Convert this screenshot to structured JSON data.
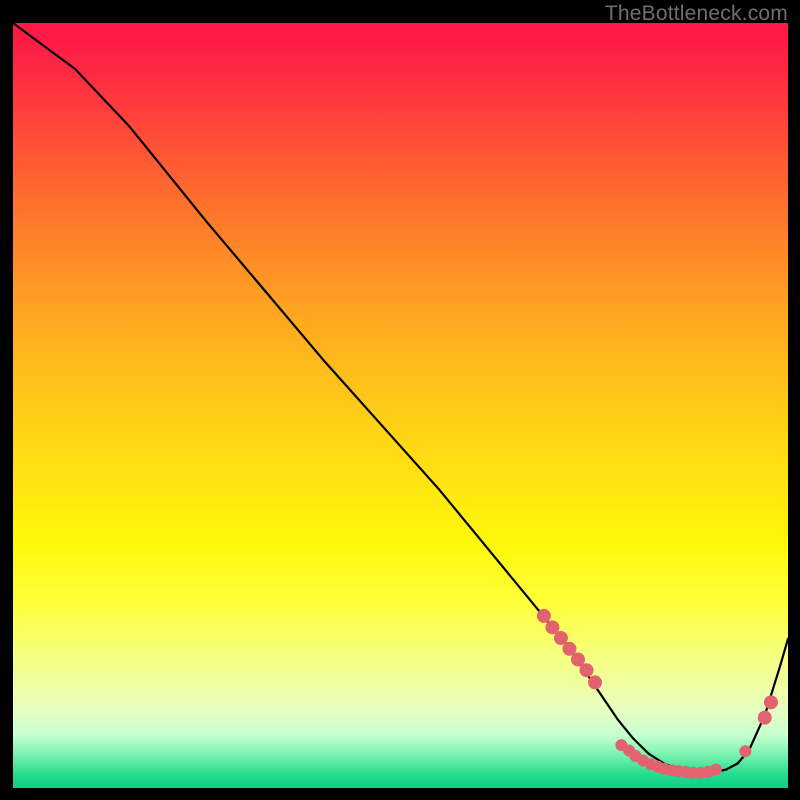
{
  "watermark": "TheBottleneck.com",
  "chart_data": {
    "type": "line",
    "title": "",
    "xlabel": "",
    "ylabel": "",
    "xlim": [
      0,
      100
    ],
    "ylim": [
      0,
      100
    ],
    "series": [
      {
        "name": "curve",
        "x": [
          0,
          4,
          8,
          15,
          25,
          40,
          55,
          68,
          72,
          74,
          76,
          78,
          80,
          82,
          84,
          86,
          88,
          90,
          92,
          93.5,
          95,
          97,
          99,
          100
        ],
        "y": [
          100,
          97,
          94,
          86.5,
          74,
          56,
          39,
          23,
          18,
          15,
          12,
          9,
          6.5,
          4.5,
          3.2,
          2.4,
          2.0,
          2.0,
          2.4,
          3.2,
          5.0,
          9.5,
          16,
          19.5
        ]
      }
    ],
    "dots": {
      "name": "highlight-points",
      "color": "#e2636f",
      "radius_major": 7,
      "radius_minor": 6,
      "points": [
        {
          "x": 68.5,
          "y": 22.5,
          "r": 7
        },
        {
          "x": 69.6,
          "y": 21.0,
          "r": 7
        },
        {
          "x": 70.7,
          "y": 19.6,
          "r": 7
        },
        {
          "x": 71.8,
          "y": 18.2,
          "r": 7
        },
        {
          "x": 72.9,
          "y": 16.8,
          "r": 7
        },
        {
          "x": 74.0,
          "y": 15.4,
          "r": 7
        },
        {
          "x": 75.1,
          "y": 13.8,
          "r": 7
        },
        {
          "x": 78.5,
          "y": 5.6,
          "r": 6
        },
        {
          "x": 79.5,
          "y": 4.9,
          "r": 6
        },
        {
          "x": 80.3,
          "y": 4.2,
          "r": 6
        },
        {
          "x": 81.3,
          "y": 3.6,
          "r": 6
        },
        {
          "x": 82.3,
          "y": 3.1,
          "r": 6
        },
        {
          "x": 83.2,
          "y": 2.8,
          "r": 6
        },
        {
          "x": 84.0,
          "y": 2.5,
          "r": 6
        },
        {
          "x": 85.0,
          "y": 2.3,
          "r": 6
        },
        {
          "x": 85.8,
          "y": 2.2,
          "r": 6
        },
        {
          "x": 86.8,
          "y": 2.1,
          "r": 6
        },
        {
          "x": 87.7,
          "y": 2.0,
          "r": 6
        },
        {
          "x": 88.7,
          "y": 2.0,
          "r": 6
        },
        {
          "x": 89.7,
          "y": 2.1,
          "r": 6
        },
        {
          "x": 90.7,
          "y": 2.4,
          "r": 6
        },
        {
          "x": 94.5,
          "y": 4.8,
          "r": 6
        },
        {
          "x": 97.0,
          "y": 9.2,
          "r": 7
        },
        {
          "x": 97.8,
          "y": 11.2,
          "r": 7
        }
      ]
    }
  }
}
